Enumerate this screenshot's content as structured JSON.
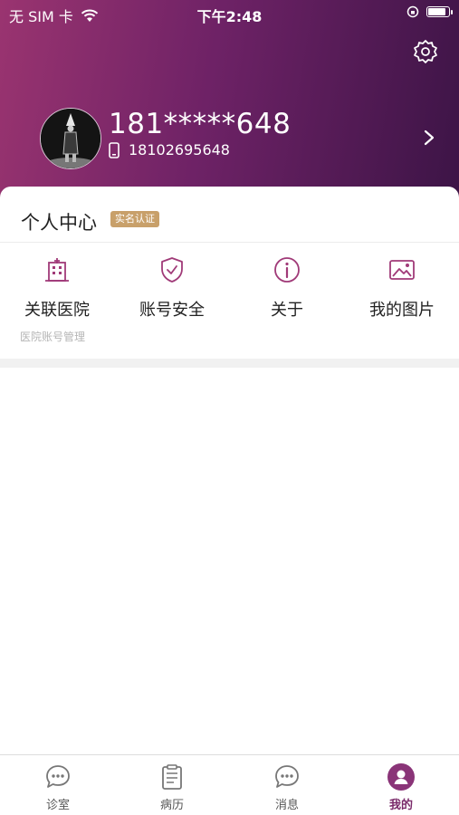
{
  "status_bar": {
    "carrier": "无 SIM 卡",
    "time": "下午2:48",
    "battery_level": 0.9
  },
  "profile": {
    "masked_name": "181*****648",
    "phone": "18102695648"
  },
  "personal_center": {
    "title": "个人中心",
    "badge": "实名认证"
  },
  "functions": [
    {
      "label": "关联医院",
      "icon": "hospital-icon",
      "sub": "医院账号管理"
    },
    {
      "label": "账号安全",
      "icon": "shield-check-icon"
    },
    {
      "label": "关于",
      "icon": "info-icon"
    },
    {
      "label": "我的图片",
      "icon": "image-icon"
    }
  ],
  "tabs": [
    {
      "label": "诊室",
      "icon": "chat-bubble-icon",
      "active": false
    },
    {
      "label": "病历",
      "icon": "clipboard-icon",
      "active": false
    },
    {
      "label": "消息",
      "icon": "message-icon",
      "active": false
    },
    {
      "label": "我的",
      "icon": "user-icon",
      "active": true
    }
  ],
  "colors": {
    "gradient_start": "#9a3470",
    "gradient_end": "#3c1446",
    "accent": "#7a2a6a",
    "badge": "#c8a06a"
  }
}
